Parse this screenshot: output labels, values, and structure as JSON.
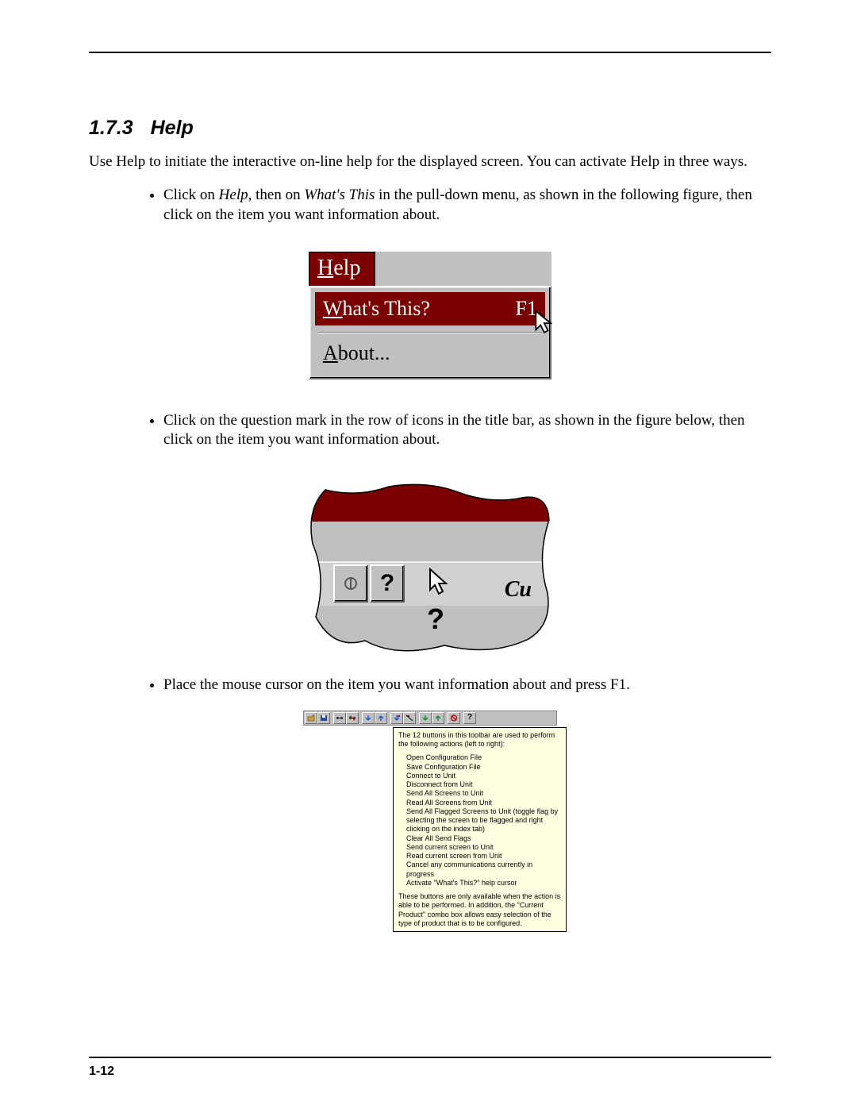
{
  "section": {
    "number": "1.7.3",
    "title": "Help"
  },
  "intro": "Use Help to initiate the interactive on-line help for the displayed screen. You can activate Help in three ways.",
  "bullets": [
    {
      "pre": "Click on ",
      "em1": "Help",
      "mid": ", then on ",
      "em2": "What's This",
      "post": " in the pull-down menu, as shown in the following figure, then click on the item you want information about."
    },
    {
      "text": "Click on the question mark in the row of icons in the title bar, as shown in the figure below, then click on the item you want information about."
    },
    {
      "text": "Place the mouse cursor on the item you want information about and press F1."
    }
  ],
  "menu": {
    "title_u": "H",
    "title_rest": "elp",
    "item1_u": "W",
    "item1_rest": "hat's This?",
    "item1_accel": "F1",
    "item2_u": "A",
    "item2_rest": "bout..."
  },
  "torn": {
    "q": "?",
    "cursor_q": "?",
    "cu": "Cu"
  },
  "tooltip": {
    "intro": "The 12 buttons in this toolbar are used to perform the following actions (left to right):",
    "items": [
      "Open Configuration File",
      "Save Configuration File",
      "Connect to Unit",
      "Disconnect from Unit",
      "Send All Screens to Unit",
      "Read All Screens from Unit",
      "Send All Flagged Screens to Unit (toggle flag by selecting the screen to be flagged and right clicking on the index tab)",
      "Clear All Send Flags",
      "Send current screen to Unit",
      "Read current screen from Unit",
      "Cancel any communications currently in progress",
      "Activate \"What's This?\" help cursor"
    ],
    "footer": "These buttons are only available when the action is able to be performed. In addition, the \"Current Product\" combo box allows easy selection of the type of product that is to be configured."
  },
  "page_number": "1-12"
}
